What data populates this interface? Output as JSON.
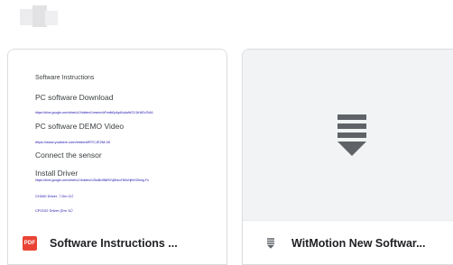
{
  "files": [
    {
      "name": "Software Instructions ...",
      "icon": "pdf-icon",
      "badge_label": "PDF",
      "badge_color": "#ea4335",
      "preview": {
        "lines": [
          "Software Instructions",
          "PC software Download",
          "https://drive.google.com/drive/u/1/folders/1mwmn4rFmdb0p4qd0oAwWCV1tH4Eo7b0A",
          "PC software DEMO Video",
          "https://www.youtube.com/embed/RTCJE2M-00",
          "Connect the sensor",
          "Install Driver",
          "https://drive.google.com/drive/u/1/folders/1Z8uBz0BkRXVj8nkuYN0uHjKbG5nhg-Fn",
          "CH340 Driver（ Dm 11）",
          "CP2102 Driver (Dm 11）"
        ]
      }
    },
    {
      "name": "WitMotion New Softwar...",
      "icon": "download-icon",
      "thumbnail_icon": "download-icon"
    }
  ]
}
